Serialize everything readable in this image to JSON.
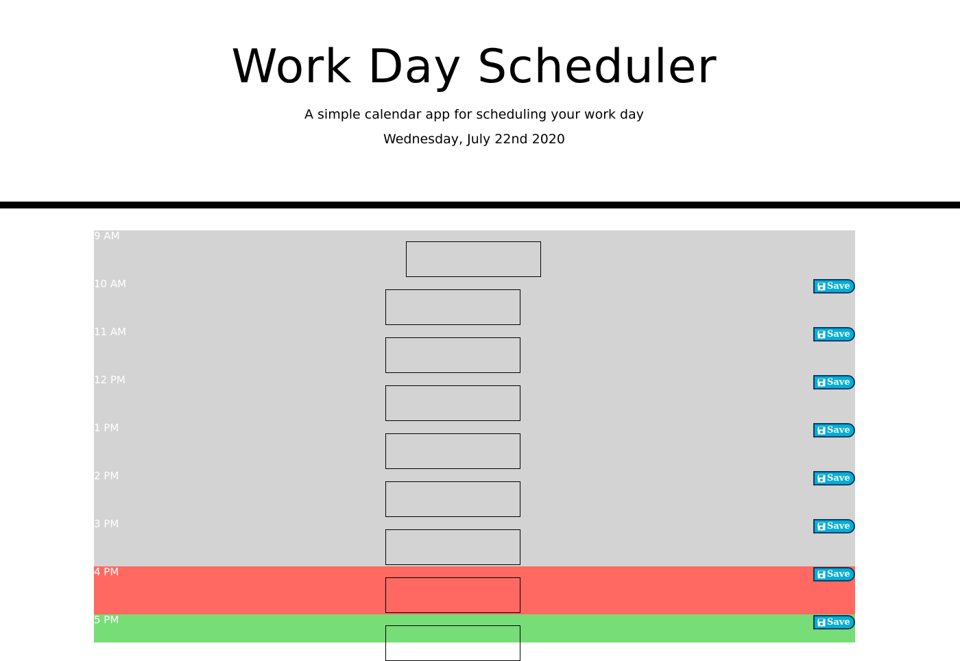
{
  "header": {
    "title": "Work Day Scheduler",
    "subtitle": "A simple calendar app for scheduling your work day",
    "current_day": "Wednesday, July 22nd 2020"
  },
  "colors": {
    "past": "#d3d3d3",
    "present": "#ff6961",
    "future": "#77dd77",
    "save_button": "#06aed5"
  },
  "save_label": "Save",
  "save_icon": "floppy-disk-icon",
  "time_blocks": [
    {
      "hour": "9 AM",
      "state": "past",
      "task": ""
    },
    {
      "hour": "10 AM",
      "state": "past",
      "task": ""
    },
    {
      "hour": "11 AM",
      "state": "past",
      "task": ""
    },
    {
      "hour": "12 PM",
      "state": "past",
      "task": ""
    },
    {
      "hour": "1 PM",
      "state": "past",
      "task": ""
    },
    {
      "hour": "2 PM",
      "state": "past",
      "task": ""
    },
    {
      "hour": "3 PM",
      "state": "past",
      "task": ""
    },
    {
      "hour": "4 PM",
      "state": "present",
      "task": ""
    },
    {
      "hour": "5 PM",
      "state": "future",
      "task": ""
    }
  ]
}
